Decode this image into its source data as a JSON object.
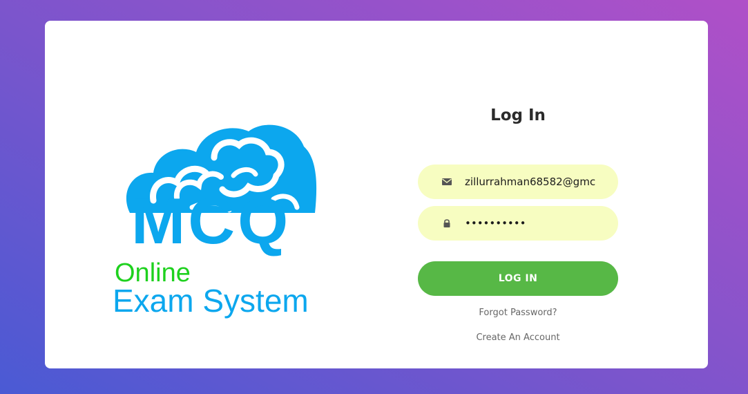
{
  "logo": {
    "brand": "MCQ",
    "tagline_top": "Online",
    "tagline_bottom": "Exam System",
    "icon": "cloud-brain-logo",
    "colors": {
      "blue": "#0ca7ee",
      "green": "#1ed11e"
    }
  },
  "form": {
    "title": "Log In",
    "email": {
      "value": "zillurrahman68582@gmc",
      "icon": "envelope-icon"
    },
    "password": {
      "value": "••••••••••",
      "icon": "lock-icon"
    },
    "login_label": "LOG IN",
    "forgot_label": "Forgot Password?",
    "create_label": "Create An Account"
  },
  "colors": {
    "field_bg": "#f7fdc1",
    "button_bg": "#57b846",
    "page_gradient": [
      "#4a5ad4",
      "#b050c8"
    ]
  }
}
